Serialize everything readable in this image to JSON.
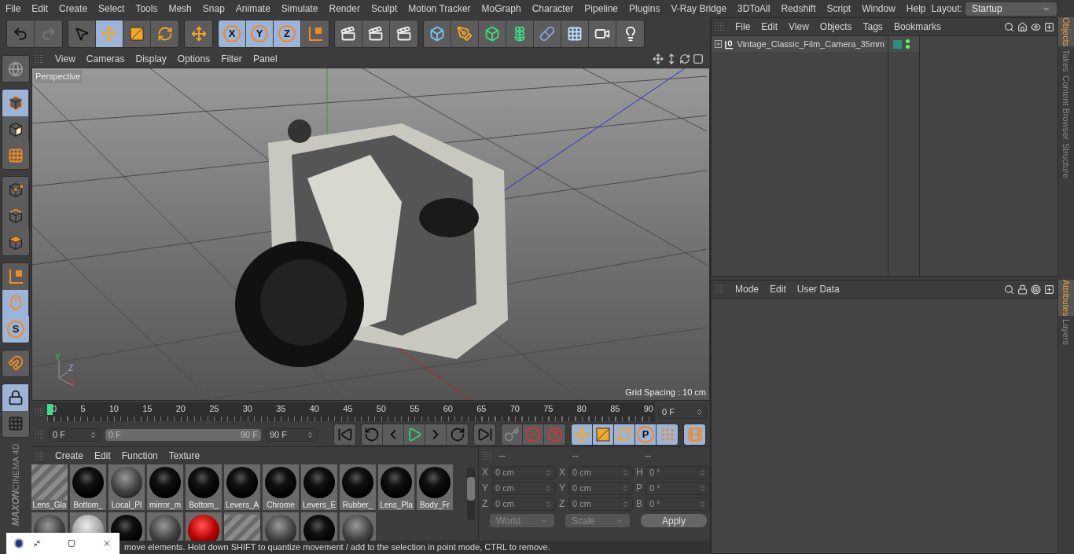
{
  "menu": [
    "File",
    "Edit",
    "Create",
    "Select",
    "Tools",
    "Mesh",
    "Snap",
    "Animate",
    "Simulate",
    "Render",
    "Sculpt",
    "Motion Tracker",
    "MoGraph",
    "Character",
    "Pipeline",
    "Plugins",
    "V-Ray Bridge",
    "3DToAll",
    "Redshift",
    "Script",
    "Window",
    "Help"
  ],
  "layout": {
    "label": "Layout:",
    "value": "Startup"
  },
  "toolbar": [
    [
      {
        "kind": "undo",
        "selected": false
      },
      {
        "kind": "redo",
        "selected": false
      }
    ],
    [
      {
        "kind": "select",
        "selected": false
      },
      {
        "kind": "move",
        "selected": true
      },
      {
        "kind": "scale",
        "selected": false
      },
      {
        "kind": "rotate",
        "selected": false
      }
    ],
    [
      {
        "kind": "move",
        "selected": false
      }
    ],
    [
      {
        "kind": "letter",
        "label": "X",
        "selected": true
      },
      {
        "kind": "letter",
        "label": "Y",
        "selected": true
      },
      {
        "kind": "letter",
        "label": "Z",
        "selected": true
      },
      {
        "kind": "axes",
        "selected": false
      }
    ],
    [
      {
        "kind": "render",
        "selected": false
      },
      {
        "kind": "render",
        "selected": false
      },
      {
        "kind": "render",
        "selected": false
      }
    ],
    [
      {
        "kind": "cube",
        "selected": false
      },
      {
        "kind": "pen",
        "selected": false
      },
      {
        "kind": "greencube",
        "selected": false
      },
      {
        "kind": "flower",
        "selected": false
      },
      {
        "kind": "capsule",
        "selected": false
      },
      {
        "kind": "floor",
        "selected": false
      },
      {
        "kind": "camera",
        "selected": false
      },
      {
        "kind": "light",
        "selected": false
      }
    ]
  ],
  "left_tools": [
    [
      {
        "kind": "globe",
        "selected": false
      }
    ],
    [
      {
        "kind": "cubeoutline",
        "selected": true
      },
      {
        "kind": "checker",
        "selected": false
      },
      {
        "kind": "grid",
        "selected": false
      }
    ],
    [
      {
        "kind": "points",
        "selected": false
      },
      {
        "kind": "edges",
        "selected": false
      },
      {
        "kind": "faces",
        "selected": false
      }
    ],
    [
      {
        "kind": "axes",
        "selected": false
      },
      {
        "kind": "mouse",
        "selected": true
      },
      {
        "kind": "letter",
        "label": "S",
        "selected": true
      }
    ],
    [
      {
        "kind": "magnet",
        "selected": false
      }
    ],
    [
      {
        "kind": "gridlock",
        "selected": true
      },
      {
        "kind": "gridrotate",
        "selected": false
      }
    ]
  ],
  "logo": [
    "MAXON",
    "CINEMA 4D"
  ],
  "viewport": {
    "menu": [
      "View",
      "Cameras",
      "Display",
      "Options",
      "Filter",
      "Panel"
    ],
    "camera_label": "Perspective",
    "grid_spacing": "Grid Spacing : 10 cm",
    "axes": [
      "Y",
      "Z",
      "X"
    ]
  },
  "timeline": {
    "ticks": [
      "0",
      "5",
      "10",
      "15",
      "20",
      "25",
      "30",
      "35",
      "40",
      "45",
      "50",
      "55",
      "60",
      "65",
      "70",
      "75",
      "80",
      "85",
      "90"
    ],
    "level": 0,
    "current_frame": "0 F"
  },
  "controls": {
    "level": 1,
    "start": "0 F",
    "range_start": "0 F",
    "range_end": "90 F",
    "end": "90 F",
    "groups": [
      [
        {
          "kind": "first",
          "selected": false
        }
      ],
      [
        {
          "kind": "prevkey",
          "selected": false
        },
        {
          "kind": "stepback",
          "selected": false
        },
        {
          "kind": "play",
          "selected": false
        },
        {
          "kind": "stepfwd",
          "selected": false
        },
        {
          "kind": "nextkey",
          "selected": false
        }
      ],
      [
        {
          "kind": "last",
          "selected": false
        }
      ],
      [
        {
          "kind": "key",
          "selected": false
        },
        {
          "kind": "record",
          "selected": false
        },
        {
          "kind": "help",
          "selected": false
        }
      ],
      [
        {
          "kind": "move",
          "selected": true
        },
        {
          "kind": "scale",
          "selected": true
        },
        {
          "kind": "rotate",
          "selected": true
        },
        {
          "kind": "letter",
          "label": "P",
          "selected": true
        },
        {
          "kind": "dots",
          "selected": true
        }
      ],
      [
        {
          "kind": "film",
          "selected": true
        }
      ]
    ]
  },
  "materials": {
    "menu": [
      "Create",
      "Edit",
      "Function",
      "Texture"
    ],
    "items": [
      {
        "name": "Lens_Gla",
        "kind": "striped"
      },
      {
        "name": "Bottom_",
        "kind": "black"
      },
      {
        "name": "Local_Pl",
        "kind": "gray"
      },
      {
        "name": "mirror_m",
        "kind": "black"
      },
      {
        "name": "Bottom_",
        "kind": "black"
      },
      {
        "name": "Levers_A",
        "kind": "black"
      },
      {
        "name": "Chrome",
        "kind": "black"
      },
      {
        "name": "Levers_E",
        "kind": "black"
      },
      {
        "name": "Rubber_",
        "kind": "black"
      },
      {
        "name": "Lens_Pla",
        "kind": "black"
      },
      {
        "name": "Body_Fr",
        "kind": "black"
      }
    ],
    "more": [
      {
        "kind": "gray"
      },
      {
        "kind": "light"
      },
      {
        "kind": "black"
      },
      {
        "kind": "gray"
      },
      {
        "kind": "red"
      },
      {
        "kind": "striped"
      },
      {
        "kind": "gray"
      },
      {
        "kind": "black"
      },
      {
        "kind": "gray"
      }
    ]
  },
  "coordinates": {
    "headers": [
      "--",
      "--",
      "--"
    ],
    "rows": [
      [
        {
          "axis": "X",
          "value": "0 cm"
        },
        {
          "axis": "X",
          "value": "0 cm"
        },
        {
          "axis": "H",
          "value": "0 °"
        }
      ],
      [
        {
          "axis": "Y",
          "value": "0 cm"
        },
        {
          "axis": "Y",
          "value": "0 cm"
        },
        {
          "axis": "P",
          "value": "0 °"
        }
      ],
      [
        {
          "axis": "Z",
          "value": "0 cm"
        },
        {
          "axis": "Z",
          "value": "0 cm"
        },
        {
          "axis": "B",
          "value": "0 °"
        }
      ]
    ],
    "space": "World",
    "mode": "Scale",
    "apply": "Apply"
  },
  "object_manager": {
    "menu": [
      "File",
      "Edit",
      "View",
      "Objects",
      "Tags",
      "Bookmarks"
    ],
    "objects": [
      {
        "name": "Vintage_Classic_Film_Camera_35mm",
        "expanded": false,
        "color": "#2a8f80"
      }
    ]
  },
  "attributes": {
    "menu": [
      "Mode",
      "Edit",
      "User Data"
    ]
  },
  "side_tabs_top": [
    {
      "label": "Objects",
      "selected": true
    },
    {
      "label": "Takes",
      "selected": false
    },
    {
      "label": "Content Browser",
      "selected": false
    },
    {
      "label": "Structure",
      "selected": false
    }
  ],
  "side_tabs_bottom": [
    {
      "label": "Attributes",
      "selected": true
    },
    {
      "label": "Layers",
      "selected": false
    }
  ],
  "status": "move elements. Hold down SHIFT to quantize movement / add to the selection in point mode, CTRL to remove."
}
